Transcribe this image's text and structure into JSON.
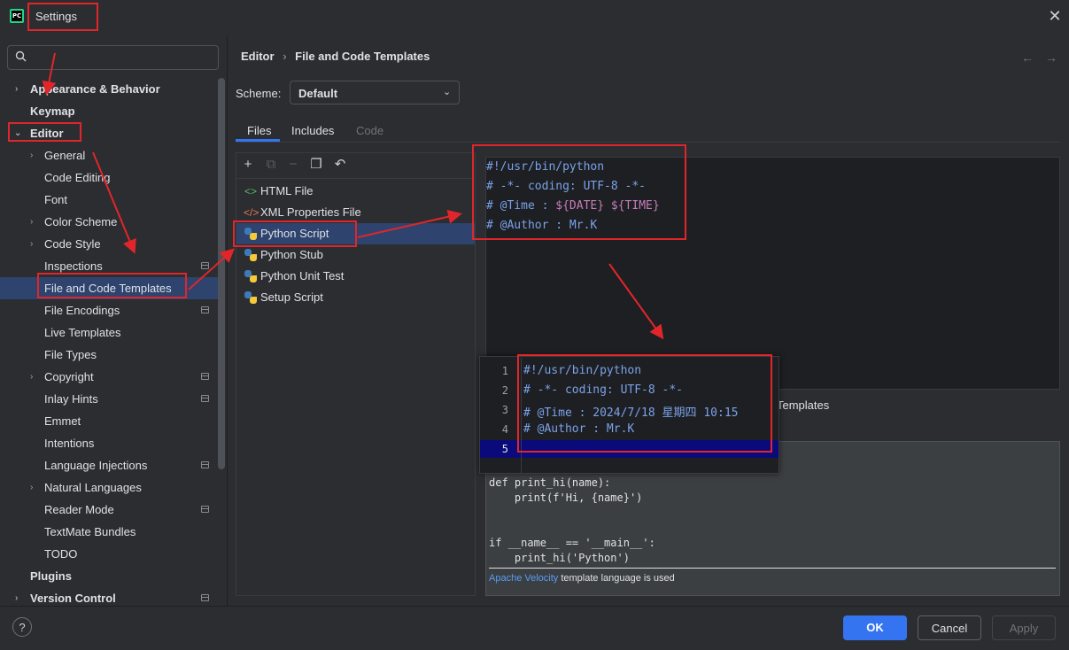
{
  "window": {
    "title": "Settings",
    "logo_text": "PC"
  },
  "search": {
    "placeholder": ""
  },
  "sidebar": {
    "items": [
      {
        "label": "Appearance & Behavior"
      },
      {
        "label": "Keymap"
      },
      {
        "label": "Editor"
      },
      {
        "label": "General"
      },
      {
        "label": "Code Editing"
      },
      {
        "label": "Font"
      },
      {
        "label": "Color Scheme"
      },
      {
        "label": "Code Style"
      },
      {
        "label": "Inspections"
      },
      {
        "label": "File and Code Templates"
      },
      {
        "label": "File Encodings"
      },
      {
        "label": "Live Templates"
      },
      {
        "label": "File Types"
      },
      {
        "label": "Copyright"
      },
      {
        "label": "Inlay Hints"
      },
      {
        "label": "Emmet"
      },
      {
        "label": "Intentions"
      },
      {
        "label": "Language Injections"
      },
      {
        "label": "Natural Languages"
      },
      {
        "label": "Reader Mode"
      },
      {
        "label": "TextMate Bundles"
      },
      {
        "label": "TODO"
      },
      {
        "label": "Plugins"
      },
      {
        "label": "Version Control"
      }
    ]
  },
  "breadcrumb": {
    "parent": "Editor",
    "separator": "›",
    "current": "File and Code Templates"
  },
  "nav": {
    "back": "←",
    "forward": "→"
  },
  "scheme": {
    "label": "Scheme:",
    "value": "Default"
  },
  "tabs": [
    {
      "label": "Files"
    },
    {
      "label": "Includes"
    },
    {
      "label": "Code"
    }
  ],
  "files": [
    {
      "label": "HTML File",
      "icon": "html-icon"
    },
    {
      "label": "XML Properties File",
      "icon": "xml-icon"
    },
    {
      "label": "Python Script",
      "icon": "python-icon"
    },
    {
      "label": "Python Stub",
      "icon": "python-icon"
    },
    {
      "label": "Python Unit Test",
      "icon": "python-icon"
    },
    {
      "label": "Setup Script",
      "icon": "python-icon"
    }
  ],
  "editor": {
    "line1": "#!/usr/bin/python",
    "line2": "# -*- coding: UTF-8 -*-",
    "line3_prefix": "# @Time : ",
    "line3_date": "${DATE}",
    "line3_time": "${TIME}",
    "line4": "# @Author : Mr.K"
  },
  "reformat_label": "Templates",
  "description": {
    "code_line1": "def print_hi(name):",
    "code_line2": "    print(f'Hi, {name}')",
    "code_line3": "if __name__ == '__main__':",
    "code_line4": "    print_hi('Python')",
    "footer_link": "Apache Velocity",
    "footer_text": " template language is used"
  },
  "popup": {
    "line_numbers": [
      "1",
      "2",
      "3",
      "4",
      "5"
    ],
    "line1": "#!/usr/bin/python",
    "line2": "# -*- coding: UTF-8 -*-",
    "line3": "# @Time : 2024/7/18 星期四 10:15",
    "line4": "# @Author : Mr.K"
  },
  "buttons": {
    "help": "?",
    "ok": "OK",
    "cancel": "Cancel",
    "apply": "Apply"
  },
  "colors": {
    "accent": "#3574f0",
    "annotation": "#e0262b",
    "selection": "#2e436e"
  }
}
